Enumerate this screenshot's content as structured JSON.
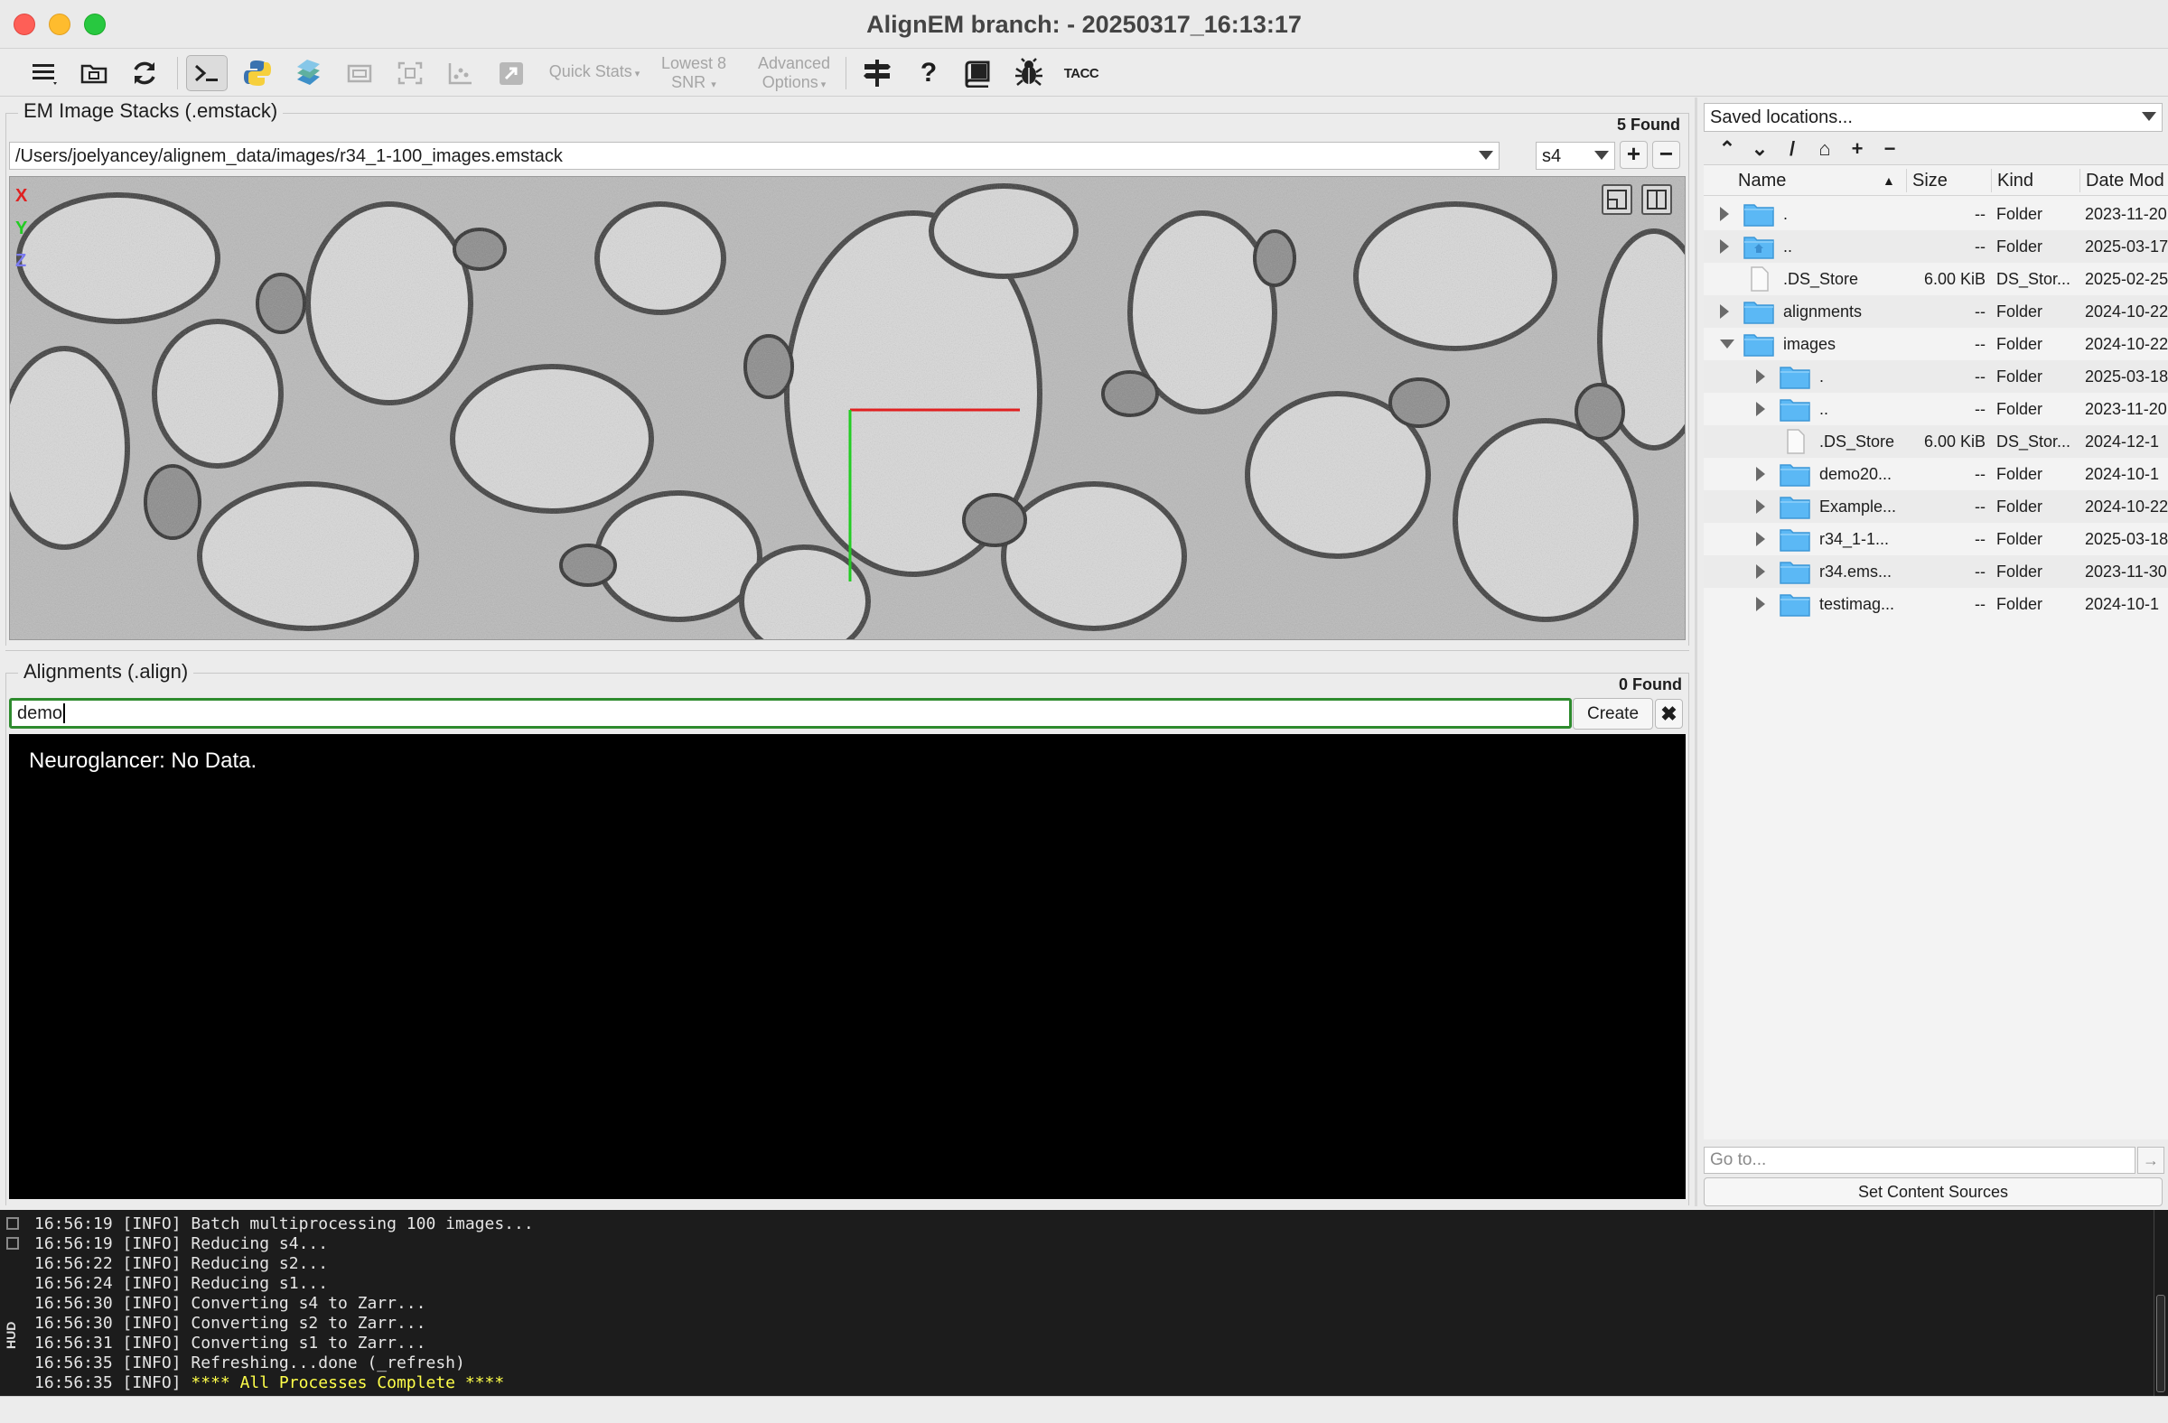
{
  "window": {
    "title": "AlignEM branch:  - 20250317_16:13:17"
  },
  "toolbar": {
    "quick_stats": "Quick Stats",
    "lowest8": [
      "Lowest 8",
      "SNR"
    ],
    "advanced": [
      "Advanced",
      "Options"
    ],
    "tacc": "TACC",
    "help": "?"
  },
  "em_stacks": {
    "title": "EM Image Stacks (.emstack)",
    "found": "5 Found",
    "path": "/Users/joelyancey/alignem_data/images/r34_1-100_images.emstack",
    "level": "s4",
    "axes": [
      "X",
      "Y",
      "Z"
    ],
    "add": "+",
    "remove": "−"
  },
  "alignments": {
    "title": "Alignments (.align)",
    "found": "0 Found",
    "input_value": "demo",
    "create_label": "Create",
    "clear_label": "✖"
  },
  "neuroglancer": {
    "message": "Neuroglancer: No Data."
  },
  "file_browser": {
    "saved_locations": "Saved locations...",
    "columns": [
      "Name",
      "Size",
      "Kind",
      "Date Mod"
    ],
    "rows": [
      {
        "name": ".",
        "size": "--",
        "kind": "Folder",
        "date": "2023-11-20",
        "depth": 0,
        "expander": "closed",
        "icon": "folder"
      },
      {
        "name": "..",
        "size": "--",
        "kind": "Folder",
        "date": "2025-03-17",
        "depth": 0,
        "expander": "closed",
        "icon": "folder-home"
      },
      {
        "name": ".DS_Store",
        "size": "6.00 KiB",
        "kind": "DS_Stor...",
        "date": "2025-02-25",
        "depth": 0,
        "expander": "none",
        "icon": "file"
      },
      {
        "name": "alignments",
        "size": "--",
        "kind": "Folder",
        "date": "2024-10-22",
        "depth": 0,
        "expander": "closed",
        "icon": "folder"
      },
      {
        "name": "images",
        "size": "--",
        "kind": "Folder",
        "date": "2024-10-22",
        "depth": 0,
        "expander": "open",
        "icon": "folder"
      },
      {
        "name": ".",
        "size": "--",
        "kind": "Folder",
        "date": "2025-03-18",
        "depth": 1,
        "expander": "closed",
        "icon": "folder"
      },
      {
        "name": "..",
        "size": "--",
        "kind": "Folder",
        "date": "2023-11-20",
        "depth": 1,
        "expander": "closed",
        "icon": "folder"
      },
      {
        "name": ".DS_Store",
        "size": "6.00 KiB",
        "kind": "DS_Stor...",
        "date": "2024-12-1",
        "depth": 1,
        "expander": "none",
        "icon": "file"
      },
      {
        "name": "demo20...",
        "size": "--",
        "kind": "Folder",
        "date": "2024-10-1",
        "depth": 1,
        "expander": "closed",
        "icon": "folder"
      },
      {
        "name": "Example...",
        "size": "--",
        "kind": "Folder",
        "date": "2024-10-22",
        "depth": 1,
        "expander": "closed",
        "icon": "folder"
      },
      {
        "name": "r34_1-1...",
        "size": "--",
        "kind": "Folder",
        "date": "2025-03-18",
        "depth": 1,
        "expander": "closed",
        "icon": "folder"
      },
      {
        "name": "r34.ems...",
        "size": "--",
        "kind": "Folder",
        "date": "2023-11-30",
        "depth": 1,
        "expander": "closed",
        "icon": "folder"
      },
      {
        "name": "testimag...",
        "size": "--",
        "kind": "Folder",
        "date": "2024-10-1",
        "depth": 1,
        "expander": "closed",
        "icon": "folder"
      }
    ],
    "goto_placeholder": "Go to...",
    "set_sources": "Set Content Sources"
  },
  "log": {
    "hud_label": "HUD",
    "lines": [
      {
        "time": "16:56:19",
        "level": "[INFO]",
        "msg": "Batch multiprocessing 100 images...",
        "highlight": false
      },
      {
        "time": "16:56:19",
        "level": "[INFO]",
        "msg": "Reducing s4...",
        "highlight": false
      },
      {
        "time": "16:56:22",
        "level": "[INFO]",
        "msg": "Reducing s2...",
        "highlight": false
      },
      {
        "time": "16:56:24",
        "level": "[INFO]",
        "msg": "Reducing s1...",
        "highlight": false
      },
      {
        "time": "16:56:30",
        "level": "[INFO]",
        "msg": "Converting s4 to Zarr...",
        "highlight": false
      },
      {
        "time": "16:56:30",
        "level": "[INFO]",
        "msg": "Converting s2 to Zarr...",
        "highlight": false
      },
      {
        "time": "16:56:31",
        "level": "[INFO]",
        "msg": "Converting s1 to Zarr...",
        "highlight": false
      },
      {
        "time": "16:56:35",
        "level": "[INFO]",
        "msg": "Refreshing...done (_refresh)",
        "highlight": false
      },
      {
        "time": "16:56:35",
        "level": "[INFO]",
        "msg": "**** All Processes Complete ****",
        "highlight": true
      }
    ]
  },
  "colors": {
    "accent_green": "#2e8b2e",
    "folder_blue": "#5bb8f5",
    "axis_x": "#e02020",
    "axis_y": "#22cc22",
    "axis_z": "#7a7af0",
    "log_highlight": "#ffff4a"
  }
}
